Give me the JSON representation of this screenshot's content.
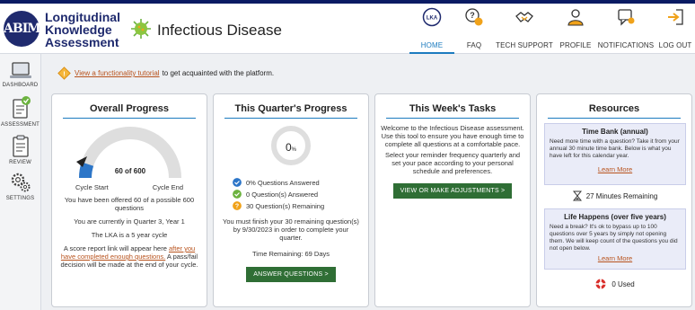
{
  "header": {
    "logo_text": "ABIM",
    "title_lines": [
      "Longitudinal",
      "Knowledge",
      "Assessment"
    ],
    "disease": "Infectious Disease"
  },
  "nav": [
    {
      "label": "HOME",
      "icon": "lka-home-icon",
      "active": true
    },
    {
      "label": "FAQ",
      "icon": "faq-icon",
      "active": false
    },
    {
      "label": "TECH SUPPORT",
      "icon": "handshake-icon",
      "active": false
    },
    {
      "label": "PROFILE",
      "icon": "user-icon",
      "active": false
    },
    {
      "label": "NOTIFICATIONS",
      "icon": "notifications-icon",
      "active": false
    },
    {
      "label": "LOG OUT",
      "icon": "logout-icon",
      "active": false
    }
  ],
  "sidebar": [
    {
      "label": "DASHBOARD",
      "icon": "laptop-icon"
    },
    {
      "label": "ASSESSMENT",
      "icon": "assessment-icon"
    },
    {
      "label": "REVIEW",
      "icon": "review-icon"
    },
    {
      "label": "SETTINGS",
      "icon": "gears-icon"
    }
  ],
  "tutorial": {
    "link": "View a functionality tutorial",
    "text": "to get acquainted with the platform."
  },
  "overall": {
    "title": "Overall Progress",
    "progress_count": "60 of 600",
    "progress_fraction": 0.1,
    "start_label": "Cycle Start",
    "end_label": "Cycle End",
    "offered_text": "You have been offered 60 of a possible 600 questions",
    "quarter_text": "You are currently in Quarter 3, Year 1",
    "cycle_text": "The LKA is a 5 year cycle",
    "score_prefix": "A score report link will appear here",
    "score_link": "after you have completed enough questions.",
    "score_suffix": "A pass/fail decision will be made at the end of your cycle."
  },
  "quarter": {
    "title": "This Quarter's Progress",
    "percent_number": "0",
    "percent_sign": "%",
    "stats": [
      {
        "text": "0% Questions Answered",
        "color": "#2d76c8",
        "icon": "check-blue-icon"
      },
      {
        "text": "0 Question(s) Answered",
        "color": "#6cb33f",
        "icon": "check-green-icon"
      },
      {
        "text": "30 Question(s) Remaining",
        "color": "#f0a21a",
        "icon": "question-orange-icon"
      }
    ],
    "deadline_text": "You must finish your 30 remaining question(s) by 9/30/2023 in order to complete your quarter.",
    "time_remaining": "Time Remaining: 69 Days",
    "button": "ANSWER QUESTIONS >"
  },
  "week": {
    "title": "This Week's Tasks",
    "p1": "Welcome to the Infectious Disease assessment. Use this tool to ensure you have enough time to complete all questions at a comfortable pace.",
    "p2": "Select your reminder frequency quarterly and set your pace according to your personal schedule and preferences.",
    "button": "VIEW OR MAKE ADJUSTMENTS >"
  },
  "resources": {
    "title": "Resources",
    "time_bank": {
      "title": "Time Bank (annual)",
      "desc": "Need more time with a question? Take it from your annual 30 minute time bank. Below is what you have left for this calendar year.",
      "link": "Learn More"
    },
    "minutes_remaining": "27 Minutes Remaining",
    "life_happens": {
      "title": "Life Happens (over five years)",
      "desc": "Need a break? It's ok to bypass up to 100 questions over 5 years by simply not opening them. We will keep count of the questions you did not open below.",
      "link": "Learn More"
    },
    "used": "0 Used"
  }
}
